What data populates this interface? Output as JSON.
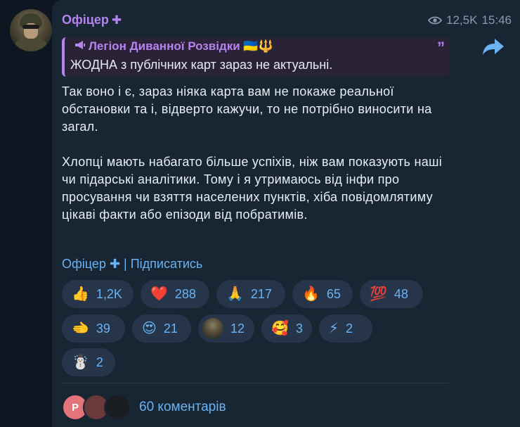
{
  "channel": {
    "name": "Офіцер",
    "badge": "✚",
    "views": "12,5K",
    "time": "15:46"
  },
  "quote": {
    "icon": "megaphone-icon",
    "title": "Легіон Диванної Розвідки",
    "flags": "🇺🇦🔱",
    "text": "ЖОДНА з публічних карт зараз не актуальні."
  },
  "message": {
    "paragraph1": "Так воно і є, зараз ніяка карта вам не покаже реальної обстановки та і, відверто кажучи, то не потрібно виносити на загал.",
    "paragraph2": "Хлопці мають набагато більше успіхів, ніж вам показують наші чи підарські аналітики. Тому і я утримаюсь від інфи про просування чи взяття населених пунктів, хіба повідомлятиму цікаві факти або епізоди від побратимів."
  },
  "footer": {
    "channel_link": "Офіцер ✚",
    "separator": " | ",
    "subscribe_link": "Підписатись"
  },
  "reactions": [
    {
      "emoji": "👍",
      "count": "1,2K"
    },
    {
      "emoji": "❤️",
      "count": "288"
    },
    {
      "emoji": "🙏",
      "count": "217"
    },
    {
      "emoji": "🔥",
      "count": "65"
    },
    {
      "emoji": "💯",
      "count": "48"
    },
    {
      "emoji": "🫲",
      "count": "39"
    },
    {
      "emoji": "😍",
      "count": "21"
    },
    {
      "emoji": "avatar",
      "count": "12"
    },
    {
      "emoji": "🥰",
      "count": "3"
    },
    {
      "emoji": "⚡",
      "count": "2"
    },
    {
      "emoji": "☃️",
      "count": "2"
    }
  ],
  "comments": {
    "avatar_initial": "Р",
    "label": "60 коментарів"
  },
  "colors": {
    "background": "#0e1621",
    "bubble": "#182533",
    "accent_purple": "#b583ee",
    "link_blue": "#6ab2f2",
    "reaction_bg": "#26354a"
  }
}
